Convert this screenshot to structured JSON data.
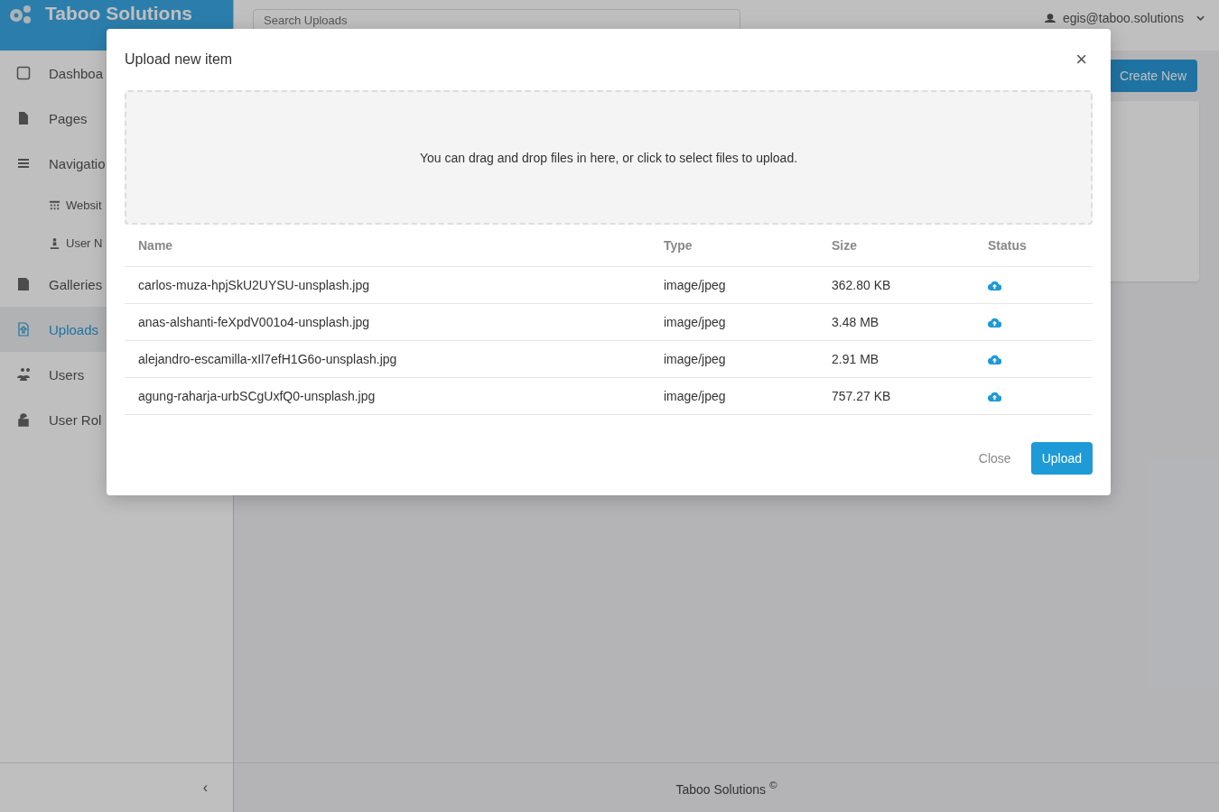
{
  "brand": {
    "title": "Taboo Solutions"
  },
  "search": {
    "placeholder": "Search Uploads"
  },
  "user": {
    "email": "egis@taboo.solutions"
  },
  "sidebar": {
    "items": [
      {
        "label": "Dashboa",
        "selected": false
      },
      {
        "label": "Pages",
        "selected": false
      },
      {
        "label": "Navigatio",
        "selected": false,
        "children": [
          {
            "label": "Websit",
            "selected": false
          },
          {
            "label": "User N",
            "selected": false
          }
        ]
      },
      {
        "label": "Galleries",
        "selected": false
      },
      {
        "label": "Uploads",
        "selected": true
      },
      {
        "label": "Users",
        "selected": false
      },
      {
        "label": "User Rol",
        "selected": false
      }
    ],
    "collapse": "‹"
  },
  "toolbar": {
    "create_button": "Create New"
  },
  "footer": {
    "text": "Taboo Solutions $^{©}$"
  },
  "modal": {
    "title": "Upload new item",
    "close": "×",
    "dropzone": "You can drag and drop files in here, or click to select files to upload.",
    "table": {
      "columns": [
        "Name",
        "Type",
        "Size",
        "Status"
      ],
      "rows": [
        {
          "name": "carlos-muza-hpjSkU2UYSU-unsplash.jpg",
          "type": "image/jpeg",
          "size": "362.80 KB"
        },
        {
          "name": "anas-alshanti-feXpdV001o4-unsplash.jpg",
          "type": "image/jpeg",
          "size": "3.48 MB"
        },
        {
          "name": "alejandro-escamilla-xIl7efH1G6o-unsplash.jpg",
          "type": "image/jpeg",
          "size": "2.91 MB"
        },
        {
          "name": "agung-raharja-urbSCgUxfQ0-unsplash.jpg",
          "type": "image/jpeg",
          "size": "757.27 KB"
        }
      ]
    },
    "buttons": {
      "close": "Close",
      "upload": "Upload"
    }
  }
}
